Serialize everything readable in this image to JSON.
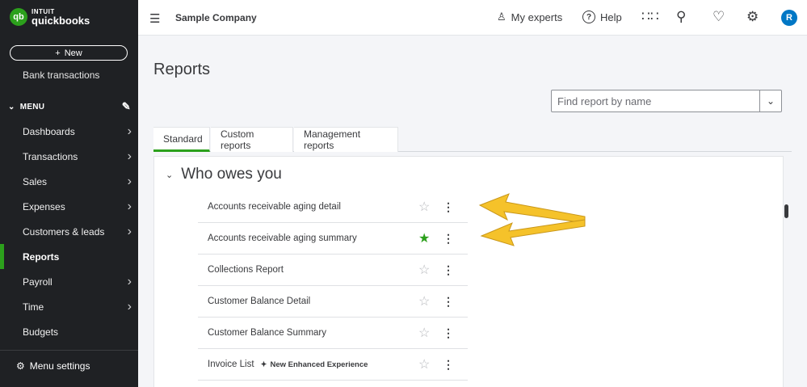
{
  "brand": {
    "intuit": "INTUIT",
    "product": "quickbooks",
    "logo_glyph": "qb",
    "accent": "#2ca01c"
  },
  "sidebar": {
    "new_label": "New",
    "bank": "Bank transactions",
    "menu_label": "MENU",
    "items": [
      {
        "label": "Dashboards",
        "has_arrow": true
      },
      {
        "label": "Transactions",
        "has_arrow": true
      },
      {
        "label": "Sales",
        "has_arrow": true
      },
      {
        "label": "Expenses",
        "has_arrow": true
      },
      {
        "label": "Customers & leads",
        "has_arrow": true
      },
      {
        "label": "Reports",
        "has_arrow": false,
        "active": true
      },
      {
        "label": "Payroll",
        "has_arrow": true
      },
      {
        "label": "Time",
        "has_arrow": true
      },
      {
        "label": "Budgets",
        "has_arrow": false
      }
    ],
    "settings_label": "Menu settings"
  },
  "topbar": {
    "company": "Sample Company",
    "experts": "My experts",
    "help": "Help",
    "avatar": "R"
  },
  "page": {
    "title": "Reports",
    "search_placeholder": "Find report by name",
    "tabs": [
      "Standard",
      "Custom reports",
      "Management reports"
    ],
    "section_title": "Who owes you",
    "reports": [
      {
        "name": "Accounts receivable aging detail",
        "favorite": false
      },
      {
        "name": "Accounts receivable aging summary",
        "favorite": true
      },
      {
        "name": "Collections Report",
        "favorite": false
      },
      {
        "name": "Customer Balance Detail",
        "favorite": false
      },
      {
        "name": "Customer Balance Summary",
        "favorite": false
      },
      {
        "name": "Invoice List",
        "favorite": false,
        "badge": "New Enhanced Experience"
      }
    ]
  }
}
